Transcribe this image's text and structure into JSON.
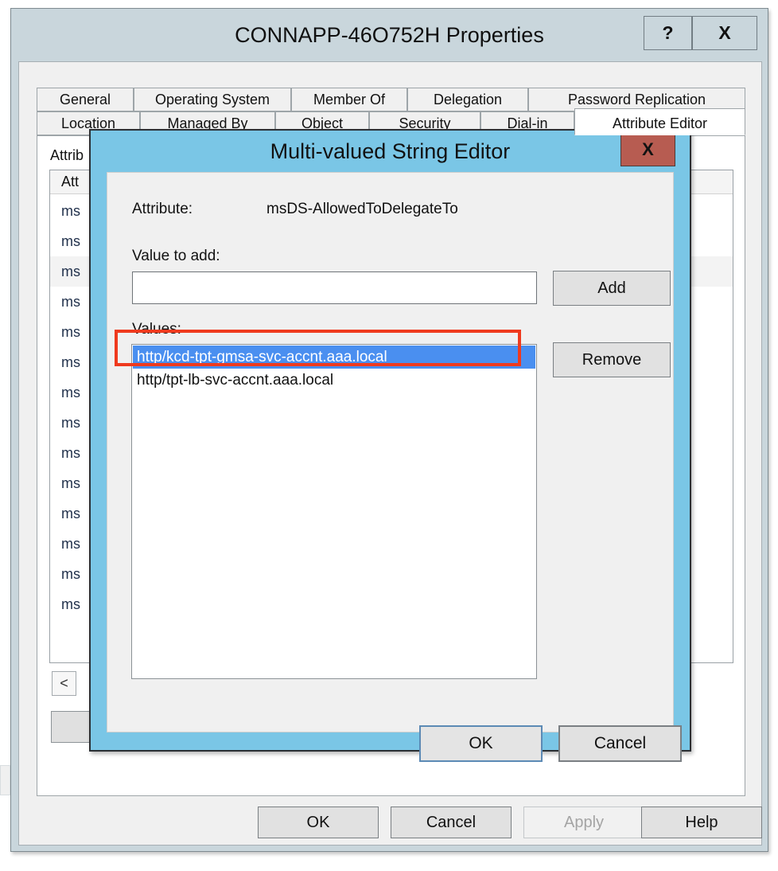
{
  "outer_window": {
    "title": "CONNAPP-46O752H Properties",
    "help_button": "?",
    "close_button": "X",
    "tabs_row1": [
      {
        "label": "General",
        "active": false
      },
      {
        "label": "Operating System",
        "active": false
      },
      {
        "label": "Member Of",
        "active": false
      },
      {
        "label": "Delegation",
        "active": false
      },
      {
        "label": "Password Replication",
        "active": false
      }
    ],
    "tabs_row2": [
      {
        "label": "Location",
        "active": false
      },
      {
        "label": "Managed By",
        "active": false
      },
      {
        "label": "Object",
        "active": false
      },
      {
        "label": "Security",
        "active": false
      },
      {
        "label": "Dial-in",
        "active": false
      },
      {
        "label": "Attribute Editor",
        "active": true
      }
    ],
    "attribute_panel": {
      "section_label": "Attrib",
      "column_header": "Att",
      "rows": [
        "ms",
        "ms",
        "ms",
        "ms",
        "ms",
        "ms",
        "ms",
        "ms",
        "ms",
        "ms",
        "ms",
        "ms",
        "ms",
        "ms"
      ],
      "scroll_left_label": "<"
    },
    "buttons": [
      {
        "label": "OK",
        "disabled": false
      },
      {
        "label": "Cancel",
        "disabled": false
      },
      {
        "label": "Apply",
        "disabled": true
      },
      {
        "label": "Help",
        "disabled": false
      }
    ]
  },
  "modal": {
    "title": "Multi-valued String Editor",
    "close_button": "X",
    "attribute_label": "Attribute:",
    "attribute_name": "msDS-AllowedToDelegateTo",
    "value_to_add_label": "Value to add:",
    "value_to_add_value": "",
    "value_to_add_placeholder": "",
    "add_button": "Add",
    "values_label": "Values:",
    "values": [
      {
        "text": "http/kcd-tpt-gmsa-svc-accnt.aaa.local",
        "selected": true
      },
      {
        "text": "http/tpt-lb-svc-accnt.aaa.local",
        "selected": false
      }
    ],
    "remove_button": "Remove",
    "ok_button": "OK",
    "cancel_button": "Cancel"
  },
  "colors": {
    "outer_titlebar": "#c9d6dc",
    "modal_titlebar": "#7ac6e6",
    "modal_close_red": "#b75c51",
    "selection_blue": "#4a8ff0",
    "annotation_red": "#ef3a1e",
    "dialog_face": "#f0f0f0"
  }
}
